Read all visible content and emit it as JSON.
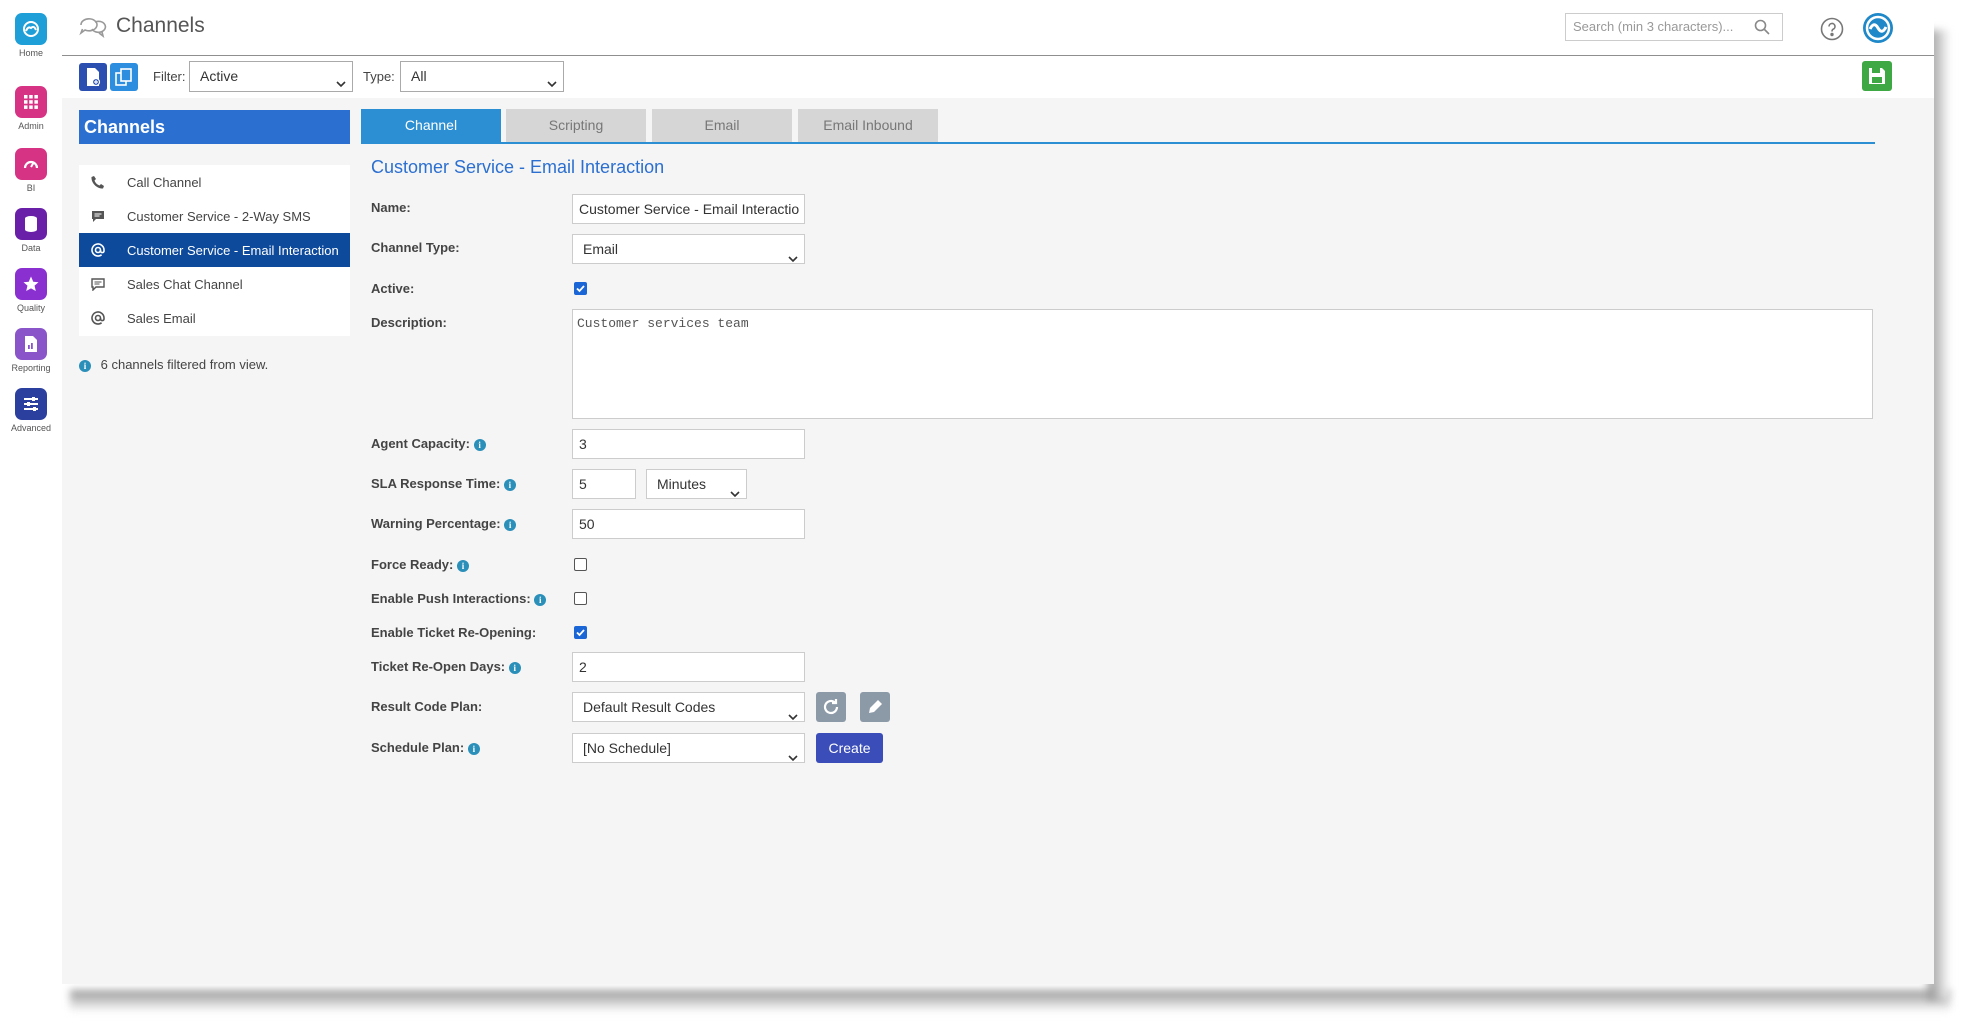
{
  "rail": {
    "items": [
      {
        "label": "Home",
        "color": "#1e9fd8"
      },
      {
        "label": "Admin",
        "color": "#d63384"
      },
      {
        "label": "BI",
        "color": "#d63384"
      },
      {
        "label": "Data",
        "color": "#6a1fa8"
      },
      {
        "label": "Quality",
        "color": "#8a2fd0"
      },
      {
        "label": "Reporting",
        "color": "#8a55c8"
      },
      {
        "label": "Advanced",
        "color": "#2a3f9e"
      }
    ]
  },
  "header": {
    "title": "Channels",
    "search_placeholder": "Search (min 3 characters)..."
  },
  "toolbar": {
    "filter_label": "Filter:",
    "filter_value": "Active",
    "type_label": "Type:",
    "type_value": "All"
  },
  "sidebar": {
    "heading": "Channels",
    "items": [
      {
        "label": "Call Channel",
        "icon": "phone-icon"
      },
      {
        "label": "Customer Service - 2-Way SMS",
        "icon": "sms-icon"
      },
      {
        "label": "Customer Service - Email Interaction",
        "icon": "at-icon",
        "selected": true
      },
      {
        "label": "Sales Chat Channel",
        "icon": "chat-icon"
      },
      {
        "label": "Sales Email",
        "icon": "at-icon"
      }
    ],
    "filtered_note": "6 channels filtered from view."
  },
  "tabs": [
    "Channel",
    "Scripting",
    "Email",
    "Email Inbound"
  ],
  "form": {
    "title": "Customer Service - Email Interaction",
    "name_label": "Name:",
    "name_value": "Customer Service - Email Interactio",
    "channel_type_label": "Channel Type:",
    "channel_type_value": "Email",
    "active_label": "Active:",
    "active": true,
    "description_label": "Description:",
    "description_value": "Customer services team",
    "agent_capacity_label": "Agent Capacity:",
    "agent_capacity_value": "3",
    "sla_label": "SLA Response Time:",
    "sla_value": "5",
    "sla_unit": "Minutes",
    "warning_label": "Warning Percentage:",
    "warning_value": "50",
    "force_ready_label": "Force Ready:",
    "force_ready": false,
    "push_label": "Enable Push Interactions:",
    "push": false,
    "reopen_label": "Enable Ticket Re-Opening:",
    "reopen": true,
    "reopen_days_label": "Ticket Re-Open Days:",
    "reopen_days_value": "2",
    "result_code_label": "Result Code Plan:",
    "result_code_value": "Default Result Codes",
    "schedule_label": "Schedule Plan:",
    "schedule_value": "[No Schedule]",
    "create_label": "Create"
  },
  "colors": {
    "accent": "#2b6fd0",
    "selected": "#0e4a9c",
    "tab_active": "#2c8fd3",
    "save": "#3ea844",
    "create": "#3a4db8"
  }
}
